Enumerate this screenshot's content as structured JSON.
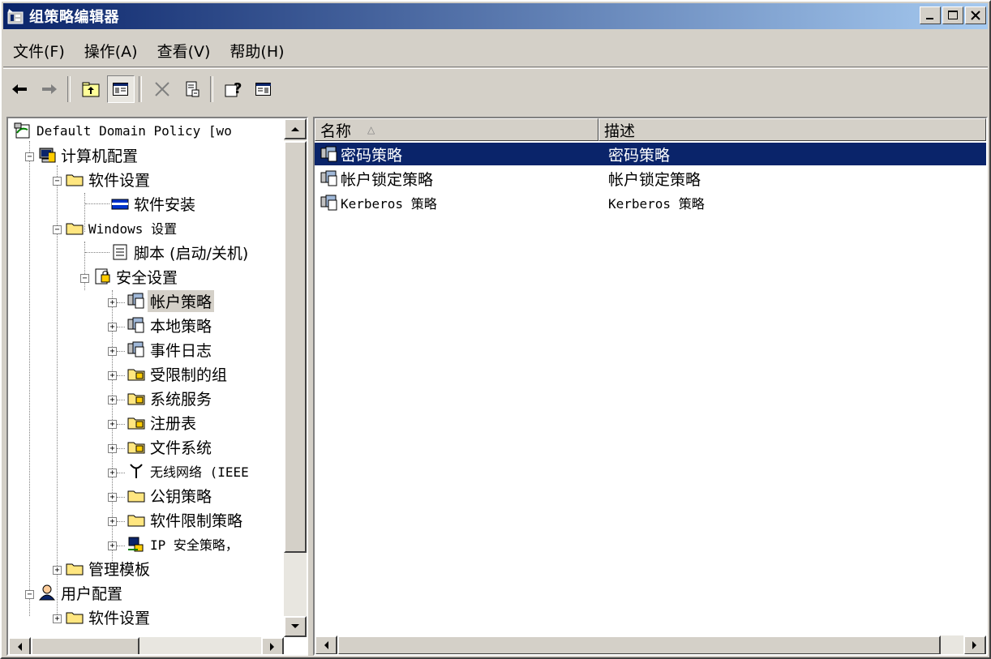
{
  "window": {
    "title": "组策略编辑器"
  },
  "menu": [
    "文件(F)",
    "操作(A)",
    "查看(V)",
    "帮助(H)"
  ],
  "toolbar": [
    "back-icon",
    "forward-icon",
    "up-folder-icon",
    "show-hide-tree-icon",
    "delete-icon",
    "properties-icon",
    "help-icon",
    "show-hide-action-pane-icon"
  ],
  "tree": [
    {
      "label": "Default Domain Policy [wo",
      "icon": "policy-icon",
      "level": 0
    },
    {
      "label": "计算机配置",
      "icon": "computer-icon",
      "level": 1
    },
    {
      "label": "软件设置",
      "icon": "folder-icon",
      "level": 2
    },
    {
      "label": "软件安装",
      "icon": "install-icon",
      "level": 3
    },
    {
      "label": "Windows 设置",
      "icon": "folder-icon",
      "level": 2
    },
    {
      "label": "脚本 (启动/关机)",
      "icon": "script-icon",
      "level": 3
    },
    {
      "label": "安全设置",
      "icon": "security-icon",
      "level": 3
    },
    {
      "label": "帐户策略",
      "icon": "policy-group-icon",
      "level": 4,
      "selected": true
    },
    {
      "label": "本地策略",
      "icon": "policy-group-icon",
      "level": 4
    },
    {
      "label": "事件日志",
      "icon": "policy-group-icon",
      "level": 4
    },
    {
      "label": "受限制的组",
      "icon": "locked-folder-icon",
      "level": 4
    },
    {
      "label": "系统服务",
      "icon": "locked-folder-icon",
      "level": 4
    },
    {
      "label": "注册表",
      "icon": "locked-folder-icon",
      "level": 4
    },
    {
      "label": "文件系统",
      "icon": "locked-folder-icon",
      "level": 4
    },
    {
      "label": "无线网络 (IEEE",
      "icon": "antenna-icon",
      "level": 4
    },
    {
      "label": "公钥策略",
      "icon": "folder-icon",
      "level": 4
    },
    {
      "label": "软件限制策略",
      "icon": "folder-icon",
      "level": 4
    },
    {
      "label": "IP 安全策略，",
      "icon": "ip-security-icon",
      "level": 4
    },
    {
      "label": "管理模板",
      "icon": "folder-icon",
      "level": 2
    },
    {
      "label": "用户配置",
      "icon": "user-icon",
      "level": 1
    },
    {
      "label": "软件设置",
      "icon": "folder-icon",
      "level": 2
    }
  ],
  "list": {
    "columns": [
      "名称",
      "描述"
    ],
    "rows": [
      {
        "name": "密码策略",
        "desc": "密码策略",
        "selected": true
      },
      {
        "name": "帐户锁定策略",
        "desc": "帐户锁定策略"
      },
      {
        "name": "Kerberos 策略",
        "desc": "Kerberos 策略"
      }
    ]
  },
  "colors": {
    "titlebar_start": "#0a246a",
    "titlebar_end": "#a6caf0",
    "selection": "#0a246a",
    "face": "#d4d0c8"
  }
}
